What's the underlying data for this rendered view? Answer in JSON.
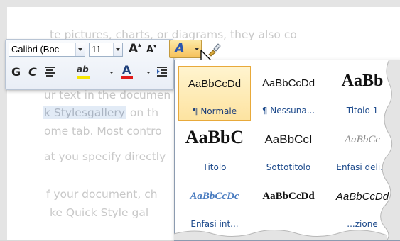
{
  "document": {
    "lines": [
      "te pictures, charts, or diagrams, they also co",
      "ur text in the documen",
      "k Styles",
      "gallery",
      " on th",
      "ome tab. Most contro",
      "at you specify directly",
      "f your document, ch",
      "ke Quick Style gal"
    ]
  },
  "mini_toolbar": {
    "font_name": "Calibri (Boc",
    "font_size": "11",
    "grow_font_glyph": "A",
    "shrink_font_glyph": "A",
    "styles_glyph": "A",
    "bold_glyph": "G",
    "italic_glyph": "C",
    "highlight_glyph": "ab",
    "font_color_glyph": "A",
    "colors": {
      "highlight": "#f7e600",
      "font_color": "#e01b1b"
    }
  },
  "styles_gallery": {
    "items": [
      {
        "sample": "AaBbCcDd",
        "label": "¶ Normale",
        "selected": true
      },
      {
        "sample": "AaBbCcDd",
        "label": "¶ Nessuna...",
        "selected": false
      },
      {
        "sample": "AaBb",
        "label": "Titolo 1",
        "selected": false
      },
      {
        "sample": "AaBbC",
        "label": "Titolo",
        "selected": false
      },
      {
        "sample": "AaBbCcI",
        "label": "Sottotitolo",
        "selected": false
      },
      {
        "sample": "AaBbCc",
        "label": "Enfasi deli...",
        "selected": false
      },
      {
        "sample": "AaBbCcDc",
        "label": "Enfasi int...",
        "selected": false
      },
      {
        "sample": "AaBbCcDd",
        "label": "",
        "selected": false
      },
      {
        "sample": "AaBbCcDd",
        "label": "...zione",
        "selected": false
      }
    ]
  }
}
